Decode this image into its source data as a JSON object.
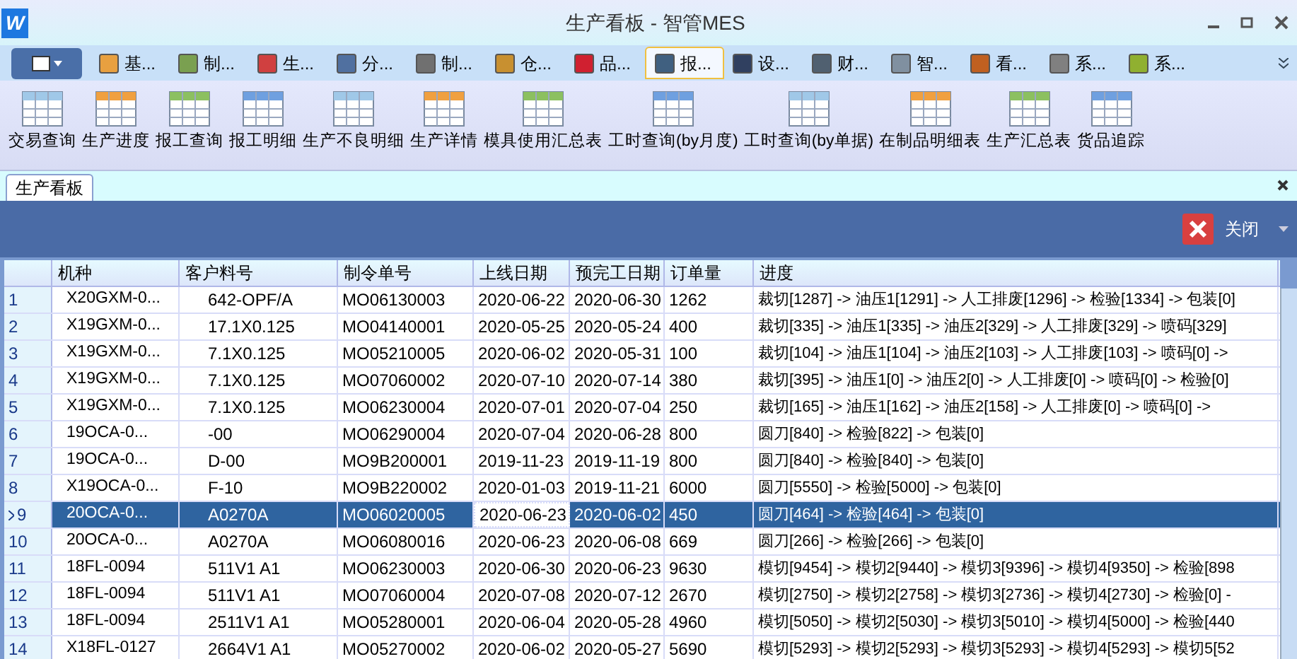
{
  "window": {
    "logo": "W",
    "title": "生产看板 - 智管MES"
  },
  "menu_tabs": [
    {
      "label": "基...",
      "selected": false
    },
    {
      "label": "制...",
      "selected": false
    },
    {
      "label": "生...",
      "selected": false
    },
    {
      "label": "分...",
      "selected": false
    },
    {
      "label": "制...",
      "selected": false
    },
    {
      "label": "仓...",
      "selected": false
    },
    {
      "label": "品...",
      "selected": false
    },
    {
      "label": "报...",
      "selected": true
    },
    {
      "label": "设...",
      "selected": false
    },
    {
      "label": "财...",
      "selected": false
    },
    {
      "label": "智...",
      "selected": false
    },
    {
      "label": "看...",
      "selected": false
    },
    {
      "label": "系...",
      "selected": false
    },
    {
      "label": "系...",
      "selected": false
    }
  ],
  "ribbon": [
    {
      "label": "交易查询"
    },
    {
      "label": "生产进度"
    },
    {
      "label": "报工查询"
    },
    {
      "label": "报工明细"
    },
    {
      "label": "生产不良明细"
    },
    {
      "label": "生产详情"
    },
    {
      "label": "模具使用汇总表"
    },
    {
      "label": "工时查询(by月度)"
    },
    {
      "label": "工时查询(by单据)"
    },
    {
      "label": "在制品明细表"
    },
    {
      "label": "生产汇总表"
    },
    {
      "label": "货品追踪"
    }
  ],
  "document_tab": {
    "label": "生产看板",
    "selected": true
  },
  "toolbar": {
    "close_button": "关闭"
  },
  "table": {
    "columns": [
      "机种",
      "客户料号",
      "制令单号",
      "上线日期",
      "预完工日期",
      "订单量",
      "进度"
    ],
    "rows": [
      {
        "index": "1",
        "selected": false,
        "cells": [
          "X20GXM-0...",
          "642-OPF/A",
          "MO06130003",
          "2020-06-22",
          "2020-06-30",
          "1262",
          "裁切[1287] -> 油压1[1291] -> 人工排废[1296] -> 检验[1334] -> 包装[0]"
        ]
      },
      {
        "index": "2",
        "selected": false,
        "cells": [
          "X19GXM-0...",
          "17.1X0.125",
          "MO04140001",
          "2020-05-25",
          "2020-05-24",
          "400",
          "裁切[335] -> 油压1[335] -> 油压2[329] -> 人工排废[329] -> 喷码[329]"
        ]
      },
      {
        "index": "3",
        "selected": false,
        "cells": [
          "X19GXM-0...",
          "7.1X0.125",
          "MO05210005",
          "2020-06-02",
          "2020-05-31",
          "100",
          "裁切[104] -> 油压1[104] -> 油压2[103] -> 人工排废[103] -> 喷码[0] ->"
        ]
      },
      {
        "index": "4",
        "selected": false,
        "cells": [
          "X19GXM-0...",
          "7.1X0.125",
          "MO07060002",
          "2020-07-10",
          "2020-07-14",
          "380",
          "裁切[395] -> 油压1[0] -> 油压2[0] -> 人工排废[0] -> 喷码[0] -> 检验[0]"
        ]
      },
      {
        "index": "5",
        "selected": false,
        "cells": [
          "X19GXM-0...",
          "7.1X0.125",
          "MO06230004",
          "2020-07-01",
          "2020-07-04",
          "250",
          "裁切[165] -> 油压1[162] -> 油压2[158] -> 人工排废[0] -> 喷码[0] ->"
        ]
      },
      {
        "index": "6",
        "selected": false,
        "cells": [
          "19OCA-0...",
          "-00",
          "MO06290004",
          "2020-07-04",
          "2020-06-28",
          "800",
          "圆刀[840] -> 检验[822] -> 包装[0]"
        ]
      },
      {
        "index": "7",
        "selected": false,
        "cells": [
          "19OCA-0...",
          "D-00",
          "MO9B200001",
          "2019-11-23",
          "2019-11-19",
          "800",
          "圆刀[840] -> 检验[840] -> 包装[0]"
        ]
      },
      {
        "index": "8",
        "selected": false,
        "cells": [
          "X19OCA-0...",
          "F-10",
          "MO9B220002",
          "2020-01-03",
          "2019-11-21",
          "6000",
          "圆刀[5550] -> 检验[5000] -> 包装[0]"
        ]
      },
      {
        "index": "9",
        "selected": true,
        "cells": [
          "20OCA-0...",
          "A0270A",
          "MO06020005",
          "2020-06-23",
          "2020-06-02",
          "450",
          "圆刀[464] -> 检验[464] -> 包装[0]"
        ]
      },
      {
        "index": "10",
        "selected": false,
        "cells": [
          "20OCA-0...",
          "A0270A",
          "MO06080016",
          "2020-06-23",
          "2020-06-08",
          "669",
          "圆刀[266] -> 检验[266] -> 包装[0]"
        ]
      },
      {
        "index": "11",
        "selected": false,
        "cells": [
          "18FL-0094",
          "511V1 A1",
          "MO06230003",
          "2020-06-30",
          "2020-06-23",
          "9630",
          "模切[9454] -> 模切2[9440] -> 模切3[9396] -> 模切4[9350] -> 检验[898"
        ]
      },
      {
        "index": "12",
        "selected": false,
        "cells": [
          "18FL-0094",
          "511V1 A1",
          "MO07060004",
          "2020-07-08",
          "2020-07-12",
          "2670",
          "模切[2750] -> 模切2[2758] -> 模切3[2736] -> 模切4[2730] -> 检验[0] -"
        ]
      },
      {
        "index": "13",
        "selected": false,
        "cells": [
          "18FL-0094",
          "2511V1 A1",
          "MO05280001",
          "2020-06-04",
          "2020-05-28",
          "4960",
          "模切[5050] -> 模切2[5030] -> 模切3[5010] -> 模切4[5000] -> 检验[440"
        ]
      },
      {
        "index": "14",
        "selected": false,
        "cells": [
          "X18FL-0127",
          "2664V1 A1",
          "MO05270002",
          "2020-06-02",
          "2020-05-27",
          "5690",
          "模切[5293] -> 模切2[5293] -> 模切3[5293] -> 模切4[5293] -> 模切5[52"
        ]
      }
    ]
  }
}
